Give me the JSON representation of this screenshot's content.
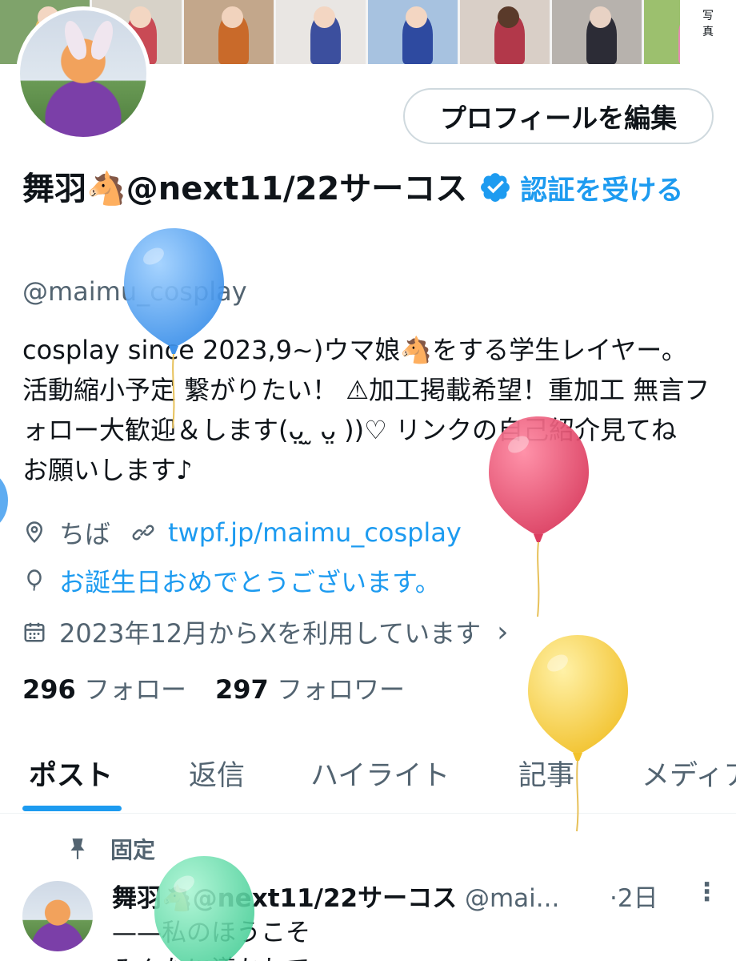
{
  "banner": {
    "photos": [
      {
        "bg": "#7fa36b",
        "fig": "#e8c06a",
        "head": "#f3d6c2"
      },
      {
        "bg": "#d7d2c8",
        "fig": "#c94a55",
        "head": "#f3d6c2"
      },
      {
        "bg": "#c3a78b",
        "fig": "#c96a2a",
        "head": "#f1d3bd"
      },
      {
        "bg": "#e9e6e3",
        "fig": "#3c4f9e",
        "head": "#f3d6c2"
      },
      {
        "bg": "#a7c2e0",
        "fig": "#2e4aa0",
        "head": "#f3d6c2"
      },
      {
        "bg": "#d9cfc7",
        "fig": "#b2384a",
        "head": "#5a3a2a"
      },
      {
        "bg": "#b7b2ad",
        "fig": "#2c2c36",
        "head": "#e8d2c4"
      },
      {
        "bg": "#9cc06e",
        "fig": "#e98ab5",
        "head": "#e9784a"
      }
    ],
    "side_label_top": "写",
    "side_label_bottom": "真"
  },
  "header": {
    "edit_profile_label": "プロフィールを編集"
  },
  "profile": {
    "display_name": "舞羽🐴@next11/22サーコス",
    "get_verified": "認証を受ける",
    "handle": "@maimu_cosplay",
    "bio": "cosplay since 2023,9~)ウマ娘🐴をする学生レイヤー。活動縮小予定 繋がりたい！ ⚠加工掲載希望！重加工 無言フォロー大歓迎＆します(ᴗ̤ ̫ ᴗ̤ ))♡ リンクの自己紹介見てね お願いします♪",
    "location": "ちば",
    "link": "twpf.jp/maimu_cosplay",
    "birthday": "お誕生日おめでとうございます。",
    "joined": "2023年12月からXを利用しています",
    "joined_chevron": "›",
    "following_count": "296",
    "following_label": "フォロー",
    "followers_count": "297",
    "followers_label": "フォロワー"
  },
  "tabs": [
    {
      "label": "ポスト",
      "active": true
    },
    {
      "label": "返信",
      "active": false
    },
    {
      "label": "ハイライト",
      "active": false
    },
    {
      "label": "記事",
      "active": false
    },
    {
      "label": "メディア",
      "active": false
    }
  ],
  "pinned_post": {
    "pinned_label": "固定",
    "author_name": "舞羽🐴@next11/22サーコス",
    "author_handle": "@mai...",
    "time": "·2日",
    "more": "⋮",
    "line1": "——私のほうこそ",
    "line2": "みんなに導かれて"
  },
  "colors": {
    "accent": "#1d9bf0",
    "secondary_text": "#536471",
    "primary_text": "#0f1419",
    "balloon_blue": "#4da3f0",
    "balloon_red": "#e44a6a",
    "balloon_yellow": "#f5cc3a",
    "balloon_green": "#5fd9a6"
  },
  "icons": {
    "verified": "verified-badge-icon",
    "location": "location-pin-icon",
    "link": "link-icon",
    "birthday": "balloon-icon",
    "calendar": "calendar-icon",
    "pin": "pin-icon"
  }
}
